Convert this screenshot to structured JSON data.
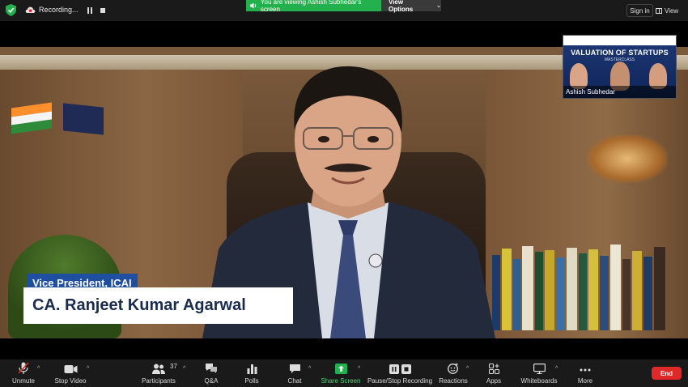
{
  "topbar": {
    "recording_label": "Recording...",
    "viewing_banner": "You are viewing Ashish Subhedar's screen",
    "view_options": "View Options",
    "sign_in": "Sign in",
    "view": "View"
  },
  "video": {
    "role_caption": "Vice President, ICAI",
    "name_caption": "CA. Ranjeet Kumar Agarwal"
  },
  "thumbnail": {
    "slide_title": "VALUATION OF STARTUPS",
    "slide_subtitle": "MASTERCLASS",
    "participant_name": "Ashish Subhedar"
  },
  "toolbar": {
    "unmute": "Unmute",
    "stop_video": "Stop Video",
    "participants": "Participants",
    "participants_count": "37",
    "qa": "Q&A",
    "polls": "Polls",
    "chat": "Chat",
    "share_screen": "Share Screen",
    "pause_stop_recording": "Pause/Stop Recording",
    "reactions": "Reactions",
    "apps": "Apps",
    "whiteboards": "Whiteboards",
    "more": "More",
    "end": "End"
  },
  "colors": {
    "share_green": "#23b14d",
    "end_red": "#e02828",
    "caption_blue": "#1f4fa0"
  }
}
